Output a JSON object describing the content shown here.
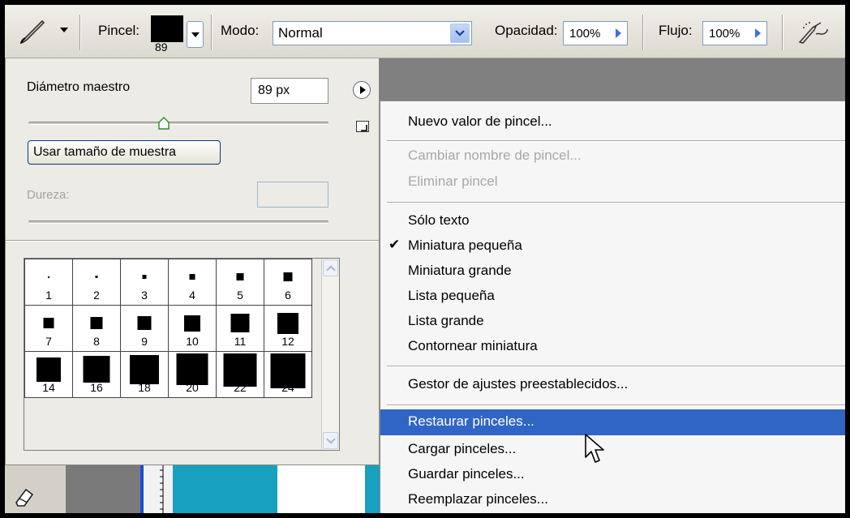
{
  "toolbar": {
    "brush_label": "Pincel:",
    "brush_size": "89",
    "mode_label": "Modo:",
    "mode_value": "Normal",
    "opacity_label": "Opacidad:",
    "opacity_value": "100%",
    "flow_label": "Flujo:",
    "flow_value": "100%",
    "icons": [
      "brush-tool-icon",
      "chevron-down-icon",
      "play-arrow-icon",
      "airbrush-icon"
    ]
  },
  "panel": {
    "diameter_label": "Diámetro maestro",
    "diameter_value": "89 px",
    "diameter_level": 0.45,
    "sample_size_button": "Usar tamaño de muestra",
    "hardness_label": "Dureza:",
    "hardness_value": "",
    "presets": [
      {
        "label": "1",
        "size": 2
      },
      {
        "label": "2",
        "size": 3
      },
      {
        "label": "3",
        "size": 5
      },
      {
        "label": "4",
        "size": 7
      },
      {
        "label": "5",
        "size": 9
      },
      {
        "label": "6",
        "size": 11
      },
      {
        "label": "7",
        "size": 13
      },
      {
        "label": "8",
        "size": 15
      },
      {
        "label": "9",
        "size": 17
      },
      {
        "label": "10",
        "size": 20
      },
      {
        "label": "11",
        "size": 23
      },
      {
        "label": "12",
        "size": 26
      },
      {
        "label": "14",
        "size": 30
      },
      {
        "label": "16",
        "size": 33
      },
      {
        "label": "18",
        "size": 36
      },
      {
        "label": "20",
        "size": 39
      },
      {
        "label": "22",
        "size": 41
      },
      {
        "label": "24",
        "size": 43
      }
    ]
  },
  "menu": {
    "new_preset": "Nuevo valor de pincel...",
    "rename": "Cambiar nombre de pincel...",
    "delete": "Eliminar pincel",
    "text_only": "Sólo texto",
    "small_thumb": "Miniatura pequeña",
    "large_thumb": "Miniatura grande",
    "small_list": "Lista pequeña",
    "large_list": "Lista grande",
    "stroke_thumb": "Contornear miniatura",
    "preset_manager": "Gestor de ajustes preestablecidos...",
    "reset": "Restaurar pinceles...",
    "load": "Cargar pinceles...",
    "save": "Guardar pinceles...",
    "replace": "Reemplazar pinceles..."
  },
  "colors": {
    "highlight": "#3165c5",
    "canvas_teal": "#18a0c0",
    "ruler_blue": "#1f4bd4"
  }
}
